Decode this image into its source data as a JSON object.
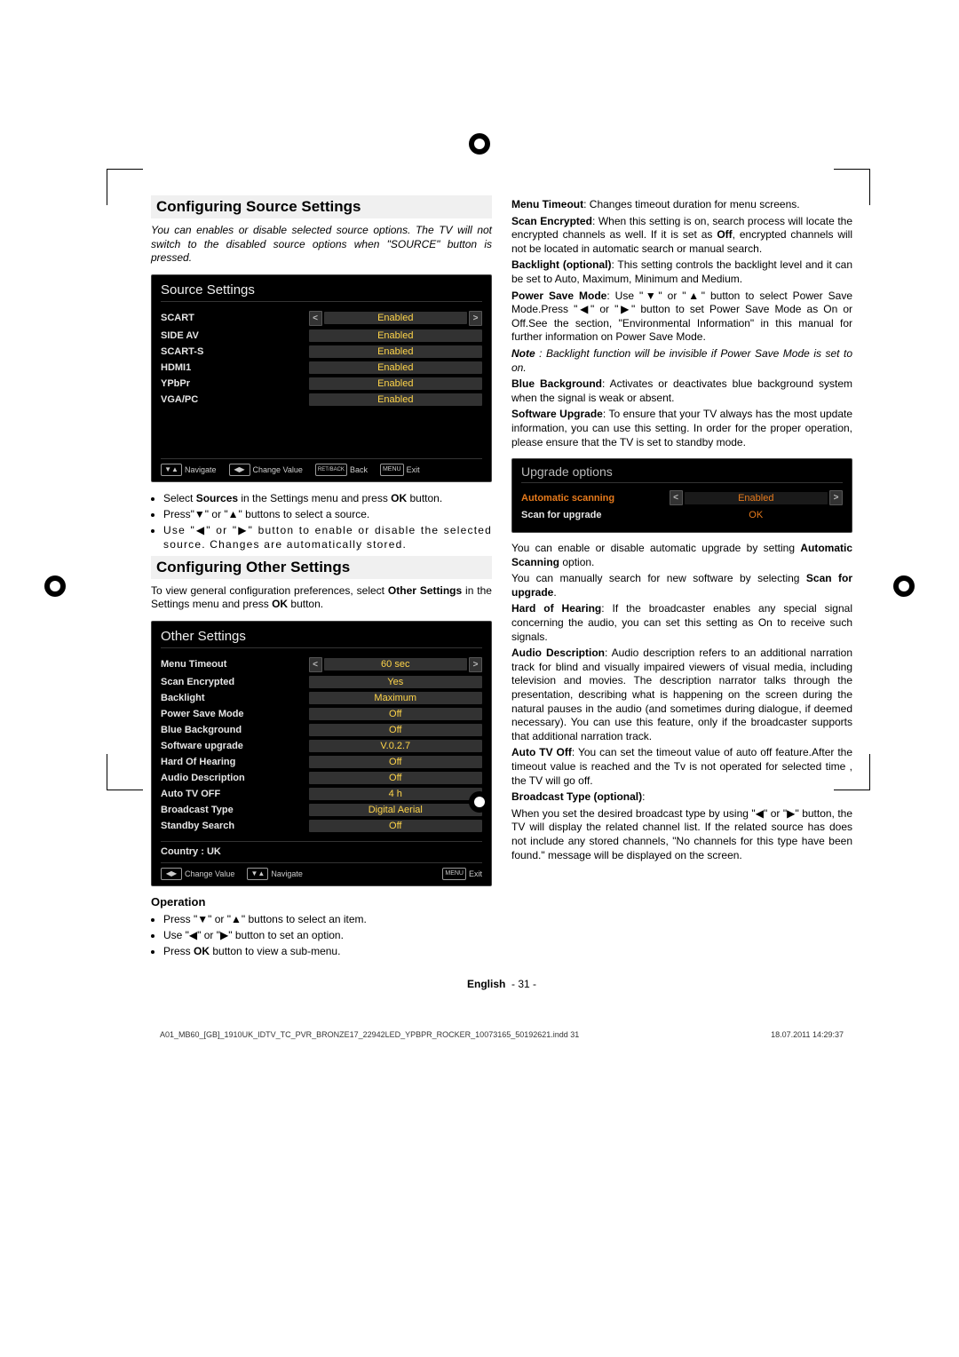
{
  "sections": {
    "config_source_title": "Configuring Source Settings",
    "config_source_intro": "You can enables or disable selected source options. The TV will not switch to the disabled source options when \"SOURCE\" button is pressed.",
    "config_other_title": "Configuring Other Settings",
    "config_other_intro_a": "To view general configuration preferences, select ",
    "config_other_intro_b": "Other Settings",
    "config_other_intro_c": " in the Settings menu and press ",
    "config_other_intro_d": "OK",
    "config_other_intro_e": " button."
  },
  "source_osd": {
    "title": "Source Settings",
    "rows": [
      {
        "label": "SCART",
        "value": "Enabled",
        "active": true
      },
      {
        "label": "SIDE AV",
        "value": "Enabled"
      },
      {
        "label": "SCART-S",
        "value": "Enabled"
      },
      {
        "label": "HDMI1",
        "value": "Enabled"
      },
      {
        "label": "YPbPr",
        "value": "Enabled"
      },
      {
        "label": "VGA/PC",
        "value": "Enabled"
      }
    ],
    "footer": {
      "nav": "Navigate",
      "change": "Change Value",
      "back_key": "RET/BACK",
      "back": "Back",
      "menu_key": "MENU",
      "exit": "Exit"
    }
  },
  "source_bullets": {
    "b1a": "Select ",
    "b1b": "Sources",
    "b1c": " in the Settings menu and press ",
    "b1d": "OK",
    "b1e": " button.",
    "b2": "Press\"▼\" or \"▲\" buttons to select a source.",
    "b3": "Use \"◀\" or \"▶\" button to enable or disable the selected source. Changes are automatically stored."
  },
  "other_osd": {
    "title": "Other Settings",
    "rows": [
      {
        "label": "Menu Timeout",
        "value": "60 sec",
        "active": true
      },
      {
        "label": "Scan Encrypted",
        "value": "Yes"
      },
      {
        "label": "Backlight",
        "value": "Maximum"
      },
      {
        "label": "Power Save Mode",
        "value": "Off"
      },
      {
        "label": "Blue Background",
        "value": "Off"
      },
      {
        "label": "Software upgrade",
        "value": "V.0.2.7"
      },
      {
        "label": "Hard Of Hearing",
        "value": "Off"
      },
      {
        "label": "Audio Description",
        "value": "Off"
      },
      {
        "label": "Auto TV OFF",
        "value": "4 h"
      },
      {
        "label": "Broadcast Type",
        "value": "Digital Aerial"
      },
      {
        "label": "Standby Search",
        "value": "Off"
      }
    ],
    "country": "Country : UK",
    "footer": {
      "change": "Change Value",
      "nav": "Navigate",
      "menu_key": "MENU",
      "exit": "Exit"
    }
  },
  "operation": {
    "heading": "Operation",
    "b1": "Press \"▼\" or \"▲\" buttons to select an item.",
    "b2": "Use \"◀\" or \"▶\" button to set an option.",
    "b3a": "Press ",
    "b3b": "OK",
    "b3c": " button to view a sub-menu."
  },
  "right": {
    "menu_timeout_label": "Menu Timeout",
    "menu_timeout_text": ": Changes timeout duration for menu screens.",
    "scan_enc_label": "Scan Encrypted",
    "scan_enc_text_a": ": When this setting is on, search process will locate the encrypted channels as well. If it is set as ",
    "scan_enc_text_b": "Off",
    "scan_enc_text_c": ", encrypted channels will not be located in automatic search or manual search.",
    "backlight_label": "Backlight (optional)",
    "backlight_text": ": This setting controls the backlight level and it can be set to Auto, Maximum, Minimum and Medium.",
    "psm_label": "Power Save Mode",
    "psm_text": ": Use \"▼\" or \"▲\" button to select Power Save Mode.Press \"◀\" or \"▶\" button to set Power Save Mode as On or Off.See the section, \"Environmental Information\" in this manual for further information on Power Save Mode.",
    "note_label": "Note ",
    "note_text": ": Backlight function will be invisible if Power Save Mode is set to on.",
    "bluebg_label": "Blue Background",
    "bluebg_text": ": Activates or deactivates blue background system when the signal is weak or absent.",
    "sw_label": "Software Upgrade",
    "sw_text": ": To ensure that your TV always has the most update information, you can use this setting. In order for the proper operation, please ensure that the TV is set to standby mode.",
    "after_upgrade_a": "You can enable or disable automatic upgrade by setting ",
    "after_upgrade_b": "Automatic Scanning",
    "after_upgrade_c": " option.",
    "scan_upgrade_a": "You can manually search for new software by selecting ",
    "scan_upgrade_b": "Scan for upgrade",
    "scan_upgrade_c": ".",
    "hoh_label": "Hard of Hearing",
    "hoh_text": ": If the broadcaster enables any special signal concerning the audio, you can set this setting as On to receive such signals.",
    "ad_label": "Audio Description",
    "ad_text": ": Audio description refers to an additional narration track for blind and visually impaired viewers of visual media, including television and movies. The description narrator talks through the presentation, describing what is happening on the screen during the natural pauses in the audio (and sometimes during dialogue, if deemed necessary). You can use this feature, only if the broadcaster supports that additional narration track.",
    "autooff_label": "Auto TV Off",
    "autooff_text": ": You can set the timeout value of auto off feature.After the timeout value is reached and the Tv is not operated for selected time , the TV will go off.",
    "bt_label": "Broadcast Type (optional)",
    "bt_colon": ":",
    "bt_text": "When you set the desired broadcast type by using \"◀\" or \"▶\" button, the TV will display the related channel list. If the related source has does not include any stored channels, \"No channels for this type have been found.\" message will be displayed on the screen."
  },
  "upgrade_osd": {
    "title": "Upgrade options",
    "rows": [
      {
        "label": "Automatic scanning",
        "value": "Enabled",
        "active": true
      },
      {
        "label": "Scan for upgrade",
        "value": "OK"
      }
    ]
  },
  "footer": {
    "lang": "English",
    "page": "- 31 -",
    "imprint_left": "A01_MB60_[GB]_1910UK_IDTV_TC_PVR_BRONZE17_22942LED_YPBPR_ROCKER_10073165_50192621.indd   31",
    "imprint_right": "18.07.2011   14:29:37"
  }
}
